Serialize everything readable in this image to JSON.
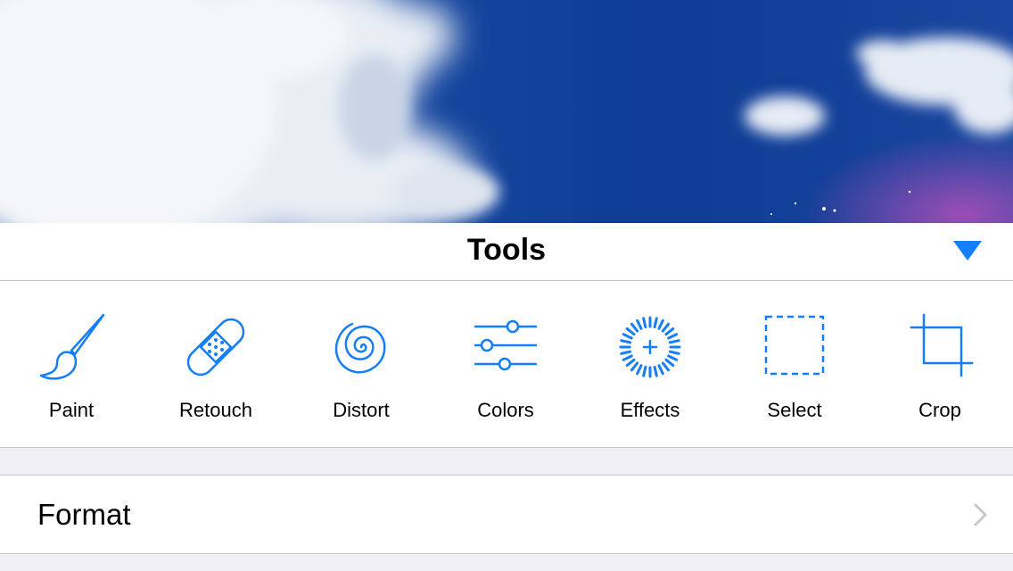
{
  "panel": {
    "title": "Tools"
  },
  "tools": [
    {
      "label": "Paint",
      "icon": "paintbrush-icon"
    },
    {
      "label": "Retouch",
      "icon": "bandage-icon"
    },
    {
      "label": "Distort",
      "icon": "spiral-icon"
    },
    {
      "label": "Colors",
      "icon": "sliders-icon"
    },
    {
      "label": "Effects",
      "icon": "sparkle-burst-icon"
    },
    {
      "label": "Select",
      "icon": "dashed-square-icon"
    },
    {
      "label": "Crop",
      "icon": "crop-icon"
    }
  ],
  "format": {
    "label": "Format"
  },
  "colors": {
    "accent": "#147efb",
    "separator": "#c8c7cc",
    "background": "#efeff4",
    "chevron": "#c7c7cc"
  }
}
